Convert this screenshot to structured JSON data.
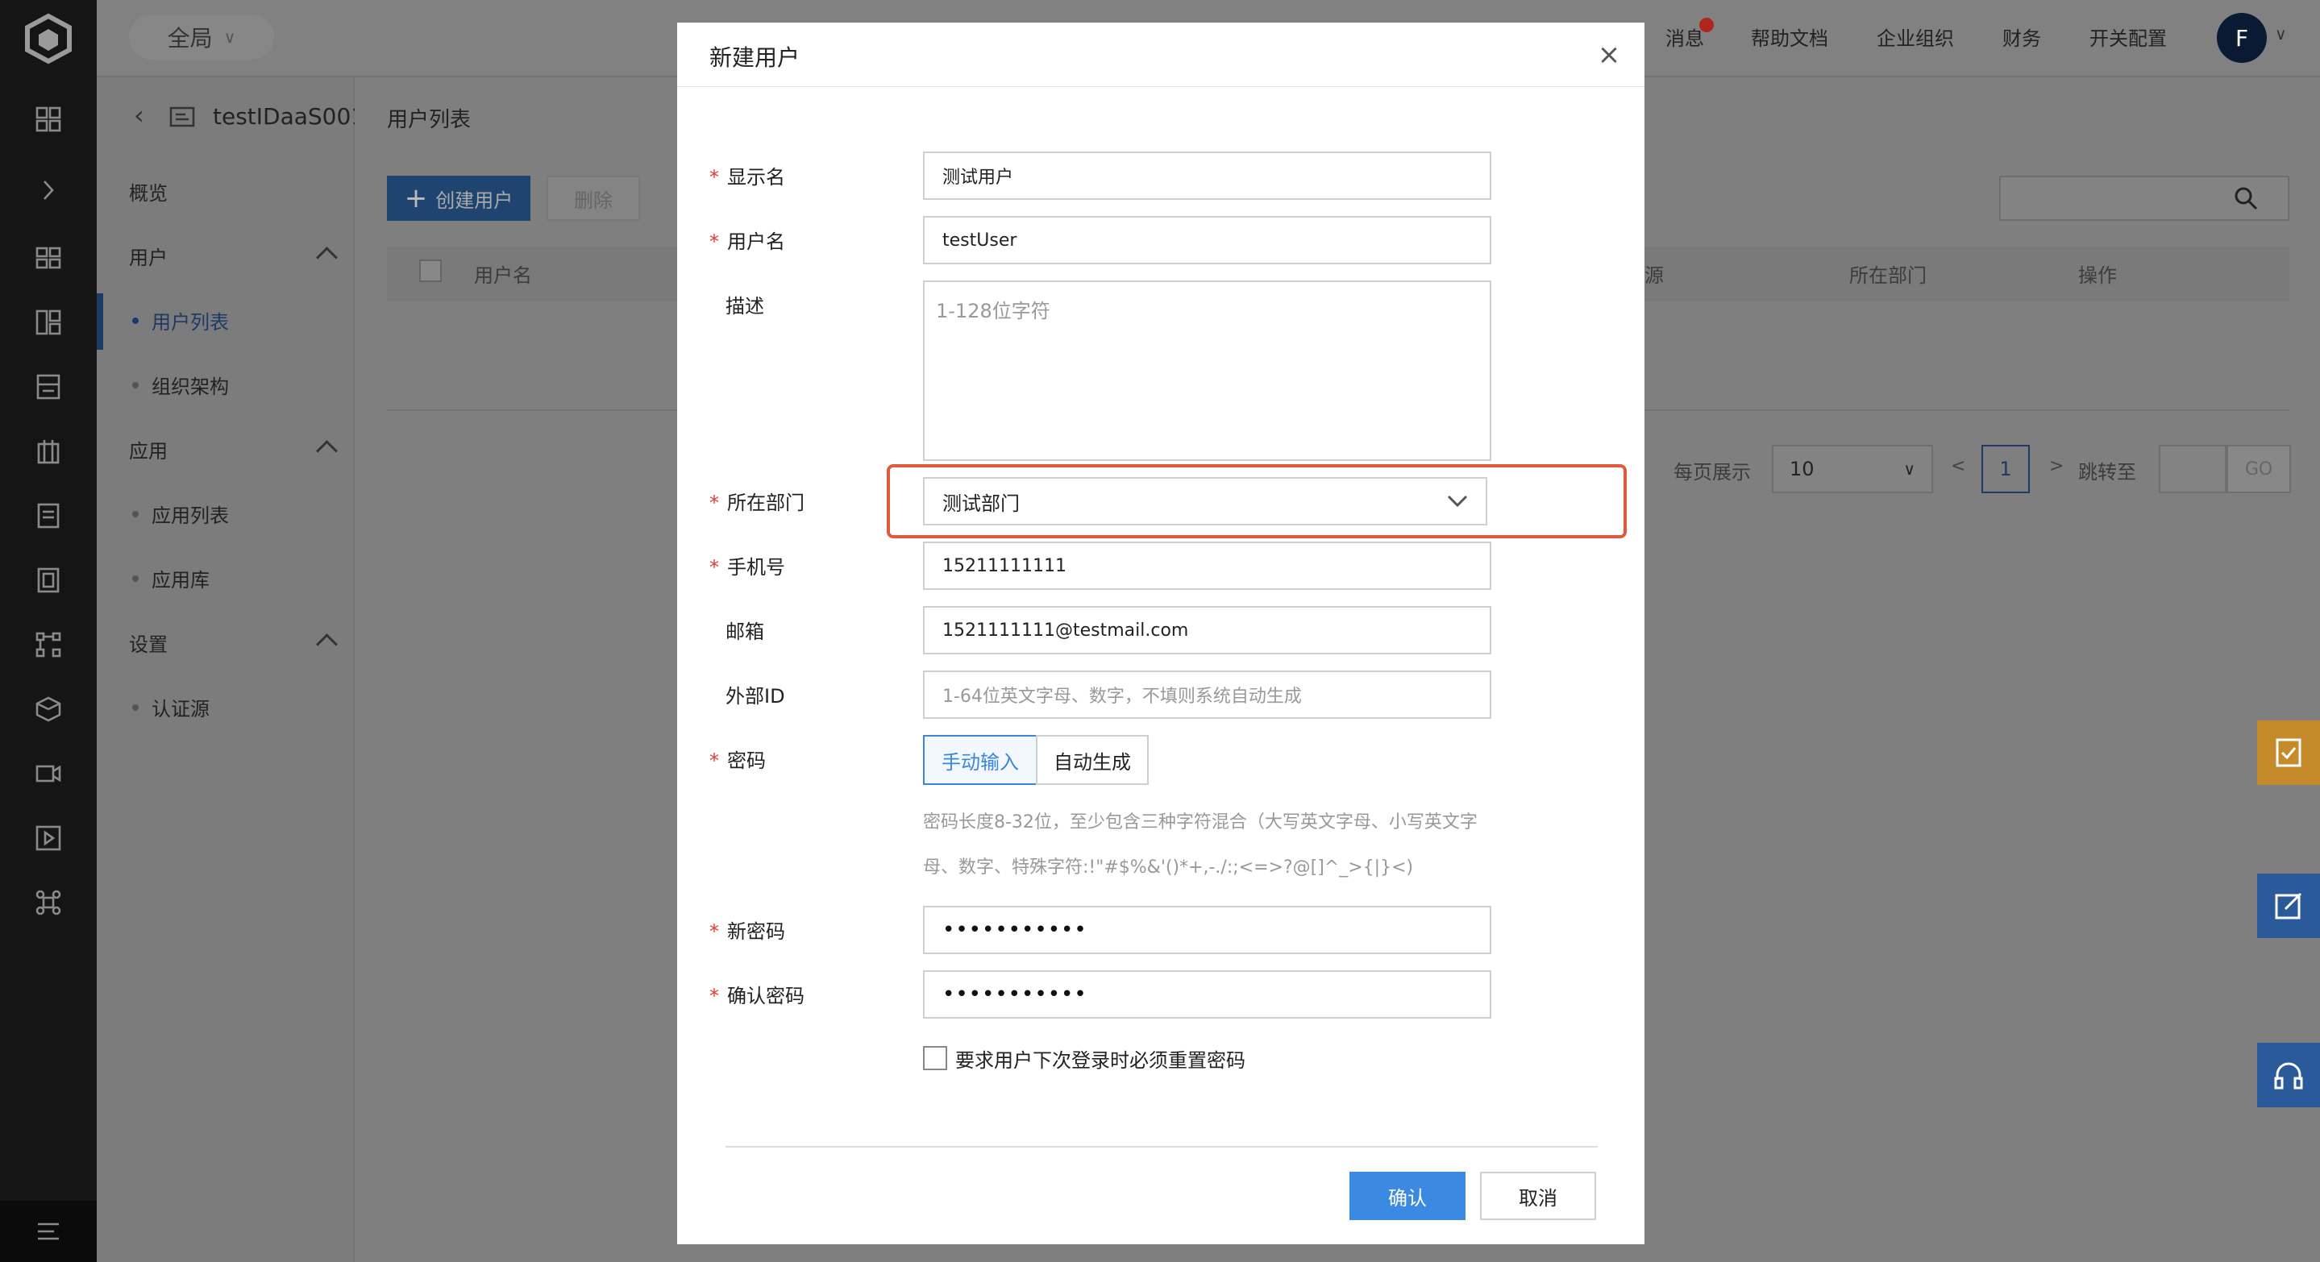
{
  "app": {
    "scope_label": "全局",
    "top_nav": [
      "消息",
      "帮助文档",
      "企业组织",
      "财务",
      "开关配置"
    ],
    "avatar_letter": "F"
  },
  "subnav": {
    "app_name": "testIDaaS001",
    "items": {
      "overview": "概览",
      "users": "用户",
      "user_list": "用户列表",
      "org": "组织架构",
      "apps": "应用",
      "app_list": "应用列表",
      "app_store": "应用库",
      "settings": "设置",
      "auth_source": "认证源"
    }
  },
  "main": {
    "title": "用户列表",
    "create_button": "创建用户",
    "delete_button": "删除",
    "columns": [
      "用户名",
      "源",
      "所在部门",
      "操作"
    ],
    "pagination": {
      "per_page_label": "每页展示",
      "per_page_value": "10",
      "prev": "<",
      "current_page": "1",
      "next": ">",
      "jump_label": "跳转至",
      "go": "GO"
    }
  },
  "modal": {
    "title": "新建用户",
    "close": "×",
    "fields": {
      "display_name": {
        "label": "显示名",
        "value": "测试用户"
      },
      "username": {
        "label": "用户名",
        "value": "testUser"
      },
      "description": {
        "label": "描述",
        "placeholder": "1-128位字符"
      },
      "department": {
        "label": "所在部门",
        "value": "测试部门"
      },
      "phone": {
        "label": "手机号",
        "value": "15211111111"
      },
      "email": {
        "label": "邮箱",
        "value": "1521111111@testmail.com"
      },
      "external_id": {
        "label": "外部ID",
        "placeholder": "1-64位英文字母、数字，不填则系统自动生成"
      },
      "password": {
        "label": "密码",
        "manual": "手动输入",
        "auto": "自动生成"
      },
      "password_hint_1": "密码长度8-32位，至少包含三种字符混合（大写英文字母、小写英文字",
      "password_hint_2": "母、数字、特殊字符:!\"#$%&'()*+,-./:;<=>?@[]^_>{|}<)",
      "new_password": {
        "label": "新密码",
        "value": "•••••••••••"
      },
      "confirm_password": {
        "label": "确认密码",
        "value": "•••••••••••"
      },
      "force_reset": "要求用户下次登录时必须重置密码"
    },
    "confirm_button": "确认",
    "cancel_button": "取消"
  },
  "colors": {
    "accent": "#3b89e0",
    "highlight_box": "#e25a3c",
    "required_mark": "#e23b2e",
    "widget_orange": "#c58a2a",
    "widget_blue": "#2a5a99"
  }
}
